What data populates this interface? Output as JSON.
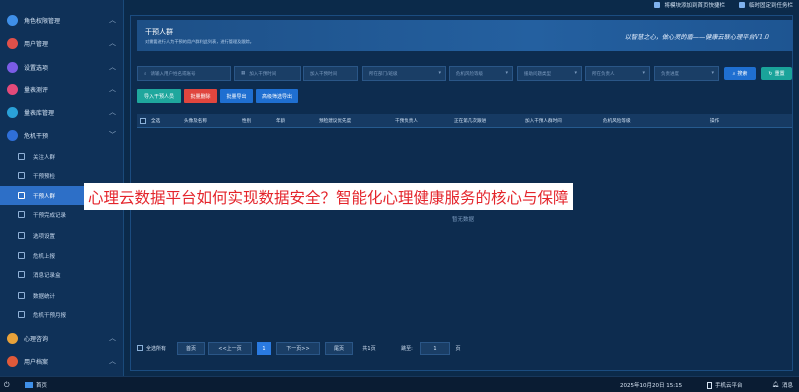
{
  "sidebar": {
    "items": [
      {
        "label": "角色权限管理",
        "icon": "shield-icon",
        "color": "#3f8fe8",
        "expanded": true
      },
      {
        "label": "用户管理",
        "icon": "user-icon",
        "color": "#e0504a",
        "expanded": true
      },
      {
        "label": "设置选项",
        "icon": "gear-icon",
        "color": "#7b5ce6",
        "expanded": true
      },
      {
        "label": "量表测评",
        "icon": "heart-icon",
        "color": "#e44a7a",
        "expanded": true
      },
      {
        "label": "量表库管理",
        "icon": "book-icon",
        "color": "#2aa1d8",
        "expanded": true
      },
      {
        "label": "危机干预",
        "icon": "alert-icon",
        "color": "#2f6fd8",
        "expanded": false
      }
    ],
    "sub_items": [
      {
        "label": "关注人群",
        "icon": "group-icon"
      },
      {
        "label": "干预预检",
        "icon": "check-icon"
      },
      {
        "label": "干预人群",
        "icon": "people-icon",
        "active": true
      },
      {
        "label": "干预完成记录",
        "icon": "record-icon"
      },
      {
        "label": "选项设置",
        "icon": "settings-icon"
      },
      {
        "label": "危机上报",
        "icon": "upload-icon"
      },
      {
        "label": "消息记录盒",
        "icon": "message-icon"
      },
      {
        "label": "数据统计",
        "icon": "stats-icon"
      },
      {
        "label": "危机干预月报",
        "icon": "report-icon"
      }
    ],
    "bottom_items": [
      {
        "label": "心理咨询",
        "icon": "chat-icon",
        "color": "#e8a23a"
      },
      {
        "label": "用户档案",
        "icon": "profile-icon",
        "color": "#e05a3a"
      }
    ]
  },
  "toplinks": [
    "将模块添加到首页快捷栏",
    "临时固定到任务栏"
  ],
  "banner": {
    "title": "干预人群",
    "subtitle": "对需要进行人为干预的用户群利此列表，进行管理及跟踪。",
    "slogan": "以智慧之心，做心灵的盾——健康云联心理平台V1.0"
  },
  "filters": [
    {
      "placeholder": "请输入用户姓名或账号",
      "icon": "search-icon"
    },
    {
      "placeholder": "加入干预时间",
      "icon": "calendar-icon"
    },
    {
      "placeholder": "加入干预时间",
      "icon": "none"
    },
    {
      "placeholder": "所在部门/班级",
      "icon": "dropdown"
    },
    {
      "placeholder": "危机风险等级",
      "icon": "dropdown"
    },
    {
      "placeholder": "援助问题类型",
      "icon": "dropdown"
    },
    {
      "placeholder": "所在负责人",
      "icon": "dropdown"
    },
    {
      "placeholder": "负责进度",
      "icon": "dropdown"
    }
  ],
  "buttons": {
    "search": "搜索",
    "reset": "重置"
  },
  "actions": [
    {
      "label": "导入干预人员",
      "color": "#1fa79d"
    },
    {
      "label": "批量删除",
      "color": "#e0463e"
    },
    {
      "label": "批量导出",
      "color": "#1f6fd1"
    },
    {
      "label": "高级筛选导出",
      "color": "#1f6fd1"
    }
  ],
  "table": {
    "columns": [
      "全选",
      "头像及名称",
      "性别",
      "年龄",
      "预检建议优先度",
      "干预负责人",
      "正在第几次跟进",
      "加入干预人群时间",
      "危机风险等级",
      "操作"
    ],
    "empty_text": "暂无数据"
  },
  "headline": "心理云数据平台如何实现数据安全？智能化心理健康服务的核心与保障",
  "pagination": {
    "select_all": "全选所有",
    "first": "首页",
    "prev": "<<上一页",
    "current": "1",
    "next": "下一页>>",
    "last": "尾页",
    "total": "共1页",
    "jump_label": "跳至:",
    "jump_value": "1",
    "page_unit": "页"
  },
  "taskbar": {
    "start": "首页",
    "datetime": "2025年10月20日 15:15",
    "mobile": "手机云平台",
    "messages": "消息"
  }
}
